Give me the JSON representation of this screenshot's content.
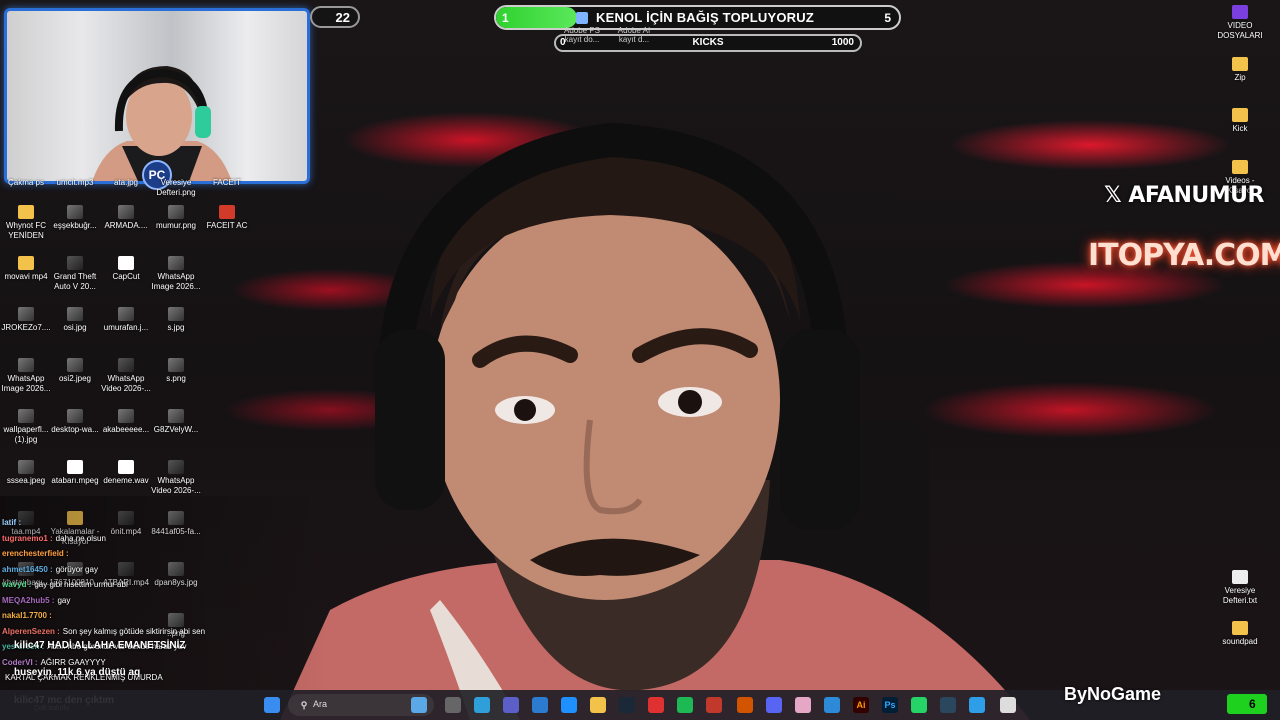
{
  "overlay": {
    "viewer_count": "22",
    "goal": {
      "start": "1",
      "title": "KENOL İÇİN BAĞIŞ TOPLUYORUZ",
      "end": "5",
      "progress": 0.2
    },
    "kicks": {
      "start": "0",
      "label": "KICKS",
      "end": "1000"
    },
    "top_mini_icons": [
      {
        "label": "Adobe PS kayıt do..."
      },
      {
        "label": "Adobe AI kayıt d..."
      }
    ],
    "webcam_badge": "PC"
  },
  "watermarks": {
    "x_handle": "𝕏 AFANUMUR",
    "sponsor": "ITOPYA.COM",
    "bottom_brand": "ByNoGame"
  },
  "desktop_left": [
    {
      "label": "Çakma ps",
      "icon": "image-icon"
    },
    {
      "label": "umcit.mp3",
      "icon": "audio-icon"
    },
    {
      "label": "ata.jpg",
      "icon": "image-icon"
    },
    {
      "label": "Veresiye Defteri.png",
      "icon": "image-icon"
    },
    {
      "label": "FACEIT",
      "icon": "faceit-icon"
    },
    {
      "label": "Whynot FC YENİDEN",
      "icon": "folder-icon"
    },
    {
      "label": "eşşekbuğr...",
      "icon": "image-icon"
    },
    {
      "label": "ARMADA....",
      "icon": "image-icon"
    },
    {
      "label": "mumur.png",
      "icon": "image-icon"
    },
    {
      "label": "FACEIT AC",
      "icon": "faceit-ac-icon"
    },
    {
      "label": "movavi mp4",
      "icon": "folder-icon"
    },
    {
      "label": "Grand Theft Auto V 20...",
      "icon": "video-icon"
    },
    {
      "label": "CapCut",
      "icon": "capcut-icon"
    },
    {
      "label": "WhatsApp Image 2026...",
      "icon": "image-icon"
    },
    {
      "label": "JROKEZo7....",
      "icon": "image-icon"
    },
    {
      "label": "osi.jpg",
      "icon": "image-icon"
    },
    {
      "label": "umurafan.j...",
      "icon": "image-icon"
    },
    {
      "label": "s.jpg",
      "icon": "image-icon"
    },
    {
      "label": "WhatsApp Image 2026...",
      "icon": "image-icon"
    },
    {
      "label": "osi2.jpeg",
      "icon": "image-icon"
    },
    {
      "label": "WhatsApp Video 2026-...",
      "icon": "video-icon"
    },
    {
      "label": "s.png",
      "icon": "image-icon"
    },
    {
      "label": "wallpaperfl... (1).jpg",
      "icon": "image-icon"
    },
    {
      "label": "desktop-wa...",
      "icon": "image-icon"
    },
    {
      "label": "akabeeeee...",
      "icon": "image-icon"
    },
    {
      "label": "G8ZVelyW...",
      "icon": "image-icon"
    },
    {
      "label": "sssea.jpeg",
      "icon": "image-icon"
    },
    {
      "label": "atabarı.mpeg",
      "icon": "media-icon"
    },
    {
      "label": "deneme.wav",
      "icon": "media-icon"
    },
    {
      "label": "WhatsApp Video 2026-...",
      "icon": "video-icon"
    },
    {
      "label": "taa.mp4",
      "icon": "video-icon"
    },
    {
      "label": "Yakalamalar - Kısayol",
      "icon": "folder-icon"
    },
    {
      "label": "önit.mp4",
      "icon": "video-icon"
    },
    {
      "label": "8441af05-fa...",
      "icon": "image-icon"
    },
    {
      "label": "khatai-bagı...",
      "icon": "image-icon"
    },
    {
      "label": "1767100810...",
      "icon": "image-icon"
    },
    {
      "label": "ATBARI.mp4",
      "icon": "video-icon"
    },
    {
      "label": "dpan8ys.jpg",
      "icon": "image-icon"
    },
    {
      "label": "..png",
      "icon": "image-icon"
    }
  ],
  "desktop_right": [
    {
      "label": "VIDEO DOSYALARI",
      "icon": "video-folder-icon"
    },
    {
      "label": "Zip",
      "icon": "folder-icon"
    },
    {
      "label": "Kick",
      "icon": "folder-icon"
    },
    {
      "label": "Videos - Kısayol",
      "icon": "folder-icon"
    },
    {
      "label": "Veresiye Defteri.txt",
      "icon": "text-file-icon"
    },
    {
      "label": "soundpad",
      "icon": "folder-icon"
    }
  ],
  "chat": [
    {
      "user": "latif :",
      "text": "",
      "color": "#9ad0ff"
    },
    {
      "user": "tugranemo1 :",
      "text": "daha ne olsun",
      "color": "#ff6b6b"
    },
    {
      "user": "erenchesterfield :",
      "text": "",
      "color": "#ff9f43"
    },
    {
      "user": "ahmet16450 :",
      "text": "görüyor gay",
      "color": "#5dade2"
    },
    {
      "user": "wavyd :",
      "text": "gay gibi hisettim urmur abi",
      "color": "#58d68d"
    },
    {
      "user": "MEQA2hub5 :",
      "text": "gay",
      "color": "#a569bd"
    },
    {
      "user": "nakal1.7700 :",
      "text": "",
      "color": "#f5b041"
    },
    {
      "user": "AlperenSezen :",
      "text": "Son şey kalmış götüde siktirirsin abi sen",
      "color": "#ec7063"
    },
    {
      "user": "yes-sreen :",
      "text": "Abi... nbe görünük var sende haraz yav",
      "color": "#45b39d"
    },
    {
      "user": "CoderVI :",
      "text": "AĞIRR GAAYYYY",
      "color": "#af7ac5"
    },
    {
      "user": "",
      "text": "KARTAL ÇAKMAK RENKLENMİŞ UMURDA",
      "color": "#ffffff"
    }
  ],
  "chat_highlight": [
    {
      "user": "kilic47",
      "text": "HADİ ALLAHA EMANETSİNİZ"
    },
    {
      "user": "huseyin_11k",
      "text": "6 ya düştü aq"
    },
    {
      "user": "kilic47",
      "text": "mc den çıktım"
    }
  ],
  "chat_sub": "Çok bulutlu",
  "taskbar": {
    "search_placeholder": "Ara",
    "kick_viewers": "6",
    "icons": [
      "windows-start-icon",
      "search-icon",
      "widget-icon",
      "task-view-icon",
      "browser-icon",
      "teams-icon",
      "vscode-icon",
      "store-icon",
      "file-explorer-icon",
      "steam-icon",
      "opera-icon",
      "spotify-icon",
      "app-red-icon",
      "x-app-icon",
      "discord-icon",
      "photos-icon",
      "app-blue-icon",
      "illustrator-icon",
      "photoshop-icon",
      "whatsapp-icon",
      "steam-alt-icon",
      "edge-icon",
      "chrome-icon"
    ]
  },
  "colors": {
    "accent_green": "#2fd12f",
    "webcam_border": "#2a6fd8",
    "taskbar_bg": "#202026"
  }
}
